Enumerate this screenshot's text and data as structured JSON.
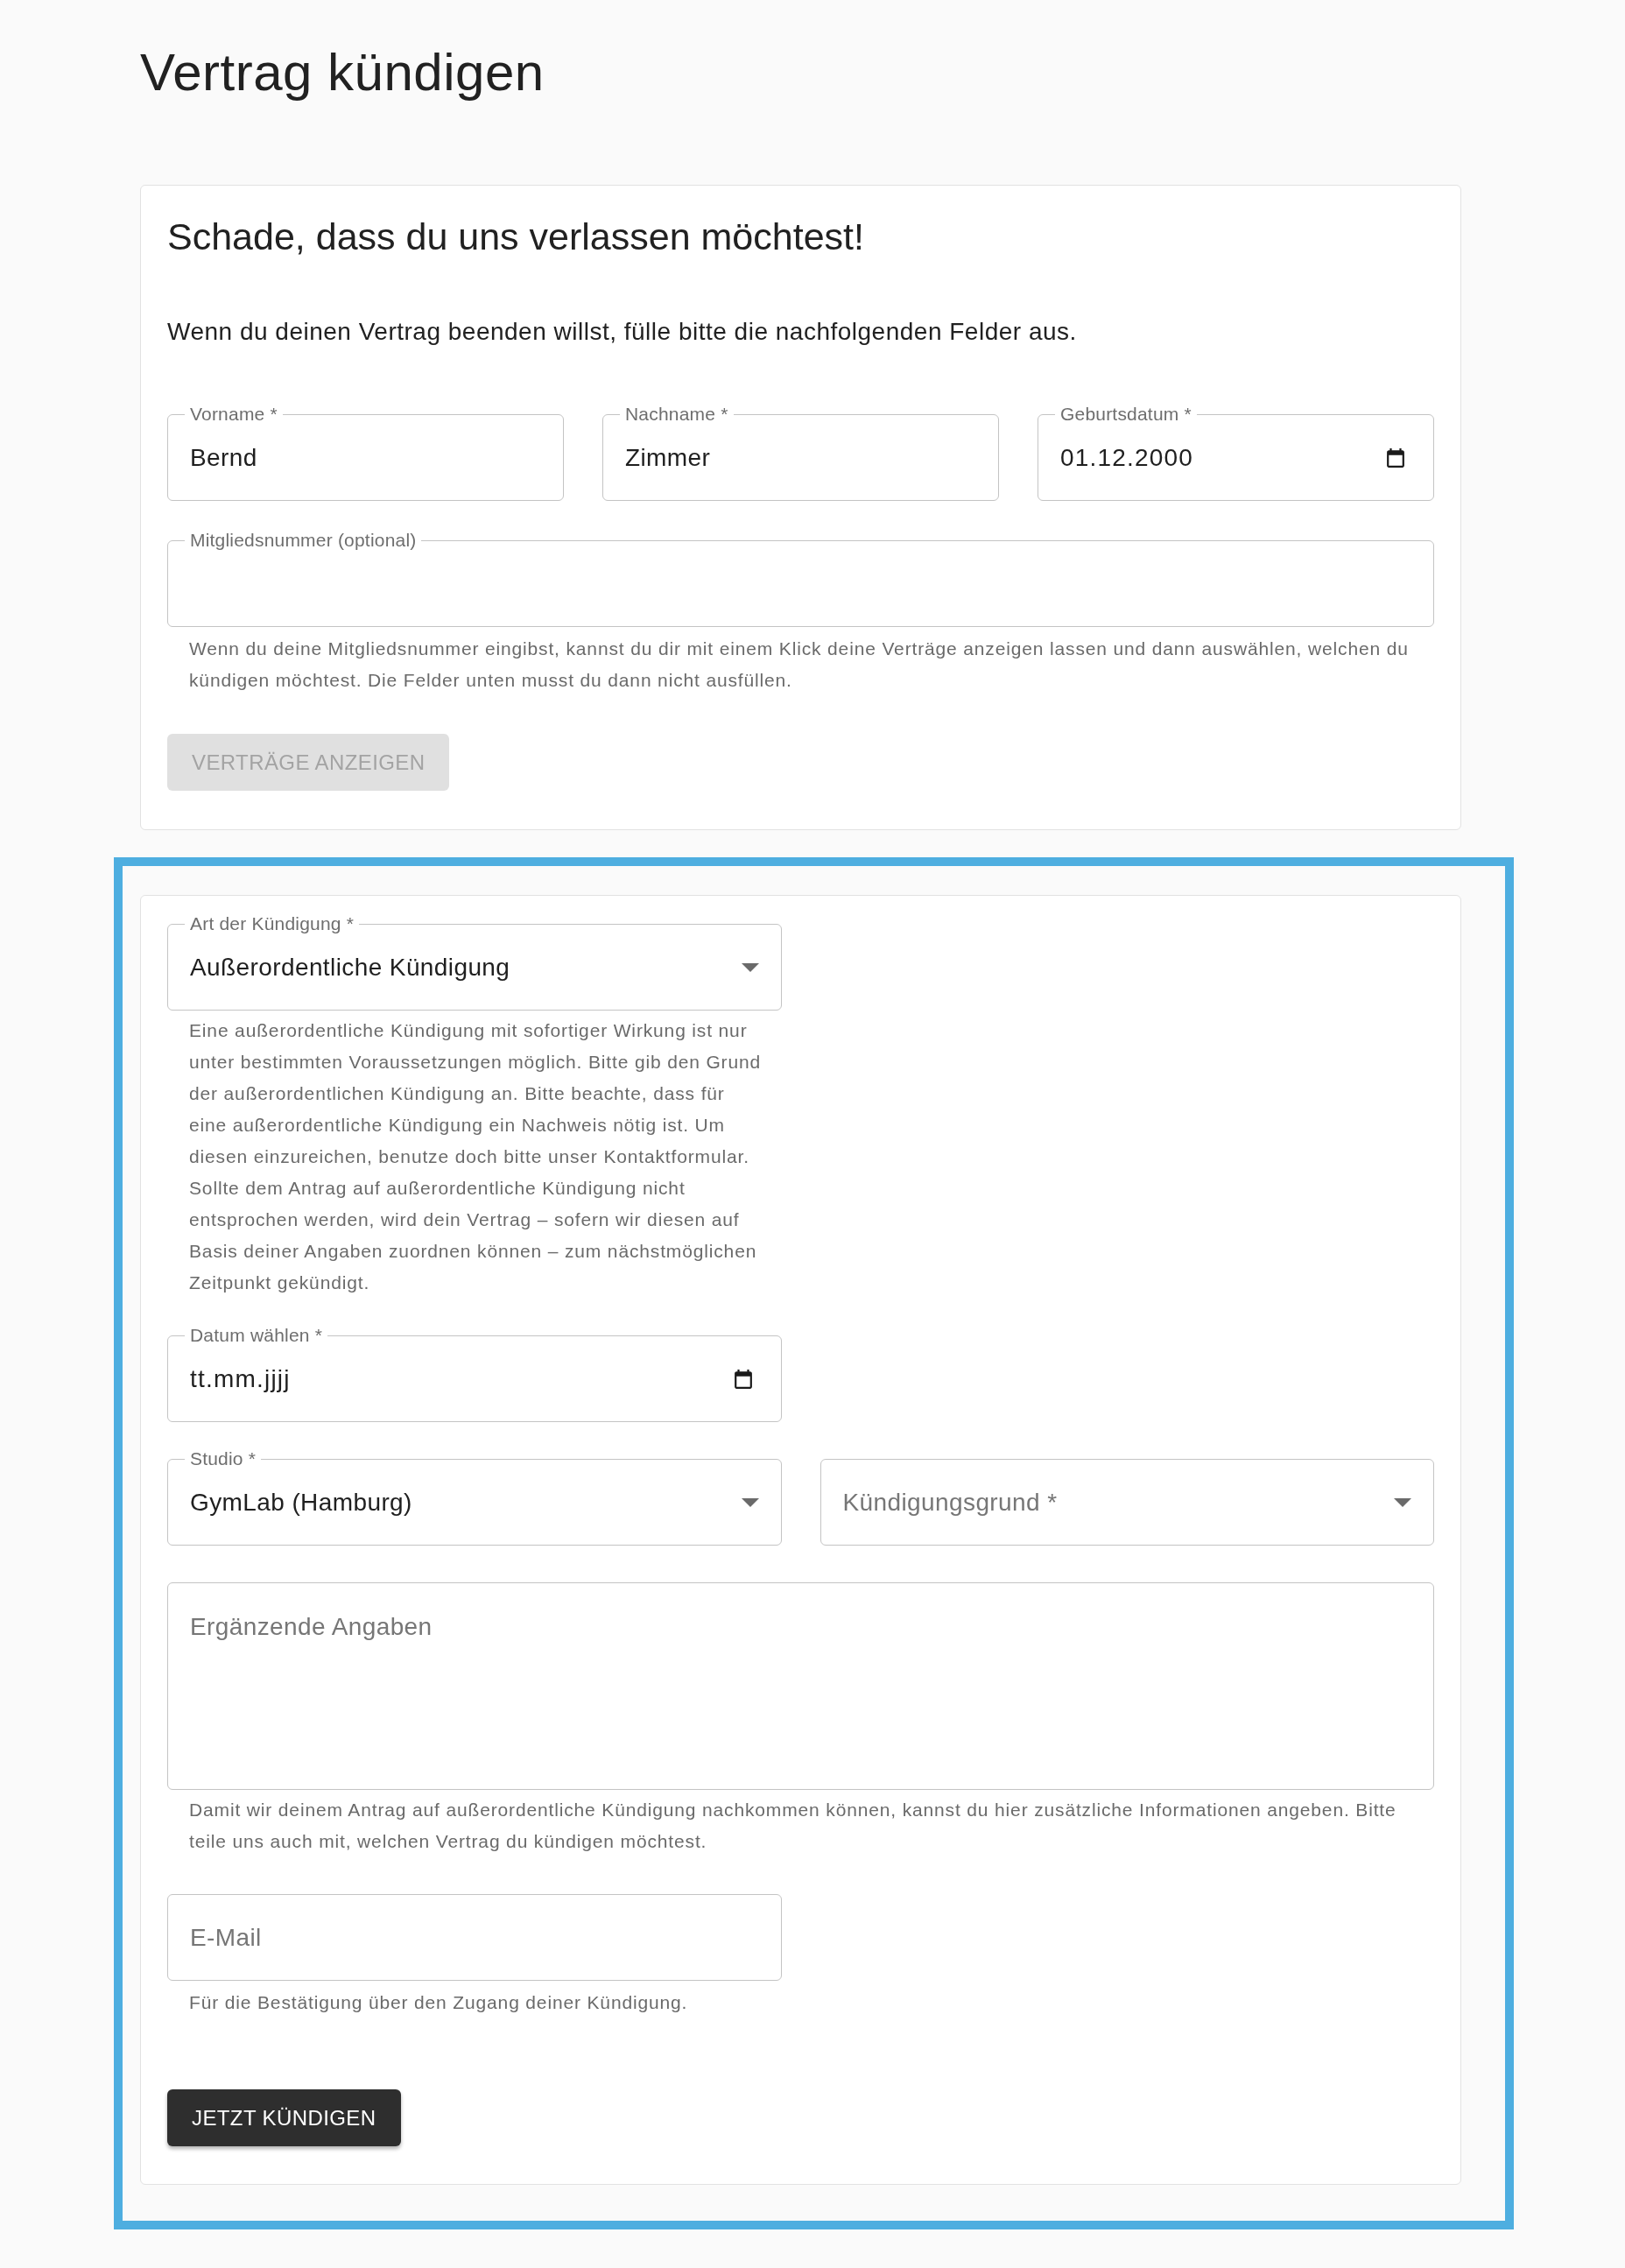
{
  "page_title": "Vertrag kündigen",
  "intro_card": {
    "heading": "Schade, dass du uns verlassen möchtest!",
    "text": "Wenn du deinen Vertrag beenden willst, fülle bitte die nachfolgenden Felder aus.",
    "fields": [
      {
        "kind": "text",
        "label": "Vorname *",
        "value": "Bernd"
      },
      {
        "kind": "text",
        "label": "Nachname *",
        "value": "Zimmer"
      },
      {
        "kind": "date",
        "label": "Geburtsdatum *",
        "value": "01.12.2000"
      }
    ],
    "member_field": {
      "kind": "text",
      "label": "Mitgliedsnummer (optional)",
      "helper": "Wenn du deine Mitgliedsnummer eingibst, kannst du dir mit einem Klick deine Verträge anzeigen lassen und dann auswählen, welchen du kündigen möchtest. Die Felder unten musst du dann nicht ausfüllen."
    },
    "button": {
      "label": "VERTRÄGE ANZEIGEN",
      "disabled": true
    }
  },
  "cancellation_card": {
    "highlighted": true,
    "rows": [
      {
        "fields": [
          {
            "kind": "select",
            "label": "Art der Kündigung *",
            "value": "Außerordentliche Kündigung",
            "helper": "Eine außerordentliche Kündigung mit sofortiger Wirkung ist nur unter bestimmten Voraussetzungen möglich. Bitte gib den Grund der außerordentlichen Kündigung an. Bitte beachte, dass für eine außerordentliche Kündigung ein Nachweis nötig ist. Um diesen einzureichen, benutze doch bitte unser Kontaktformular. Sollte dem Antrag auf außerordentliche Kündigung nicht entsprochen werden, wird dein Vertrag – sofern wir diesen auf Basis deiner Angaben zuordnen können – zum nächstmöglichen Zeitpunkt gekündigt."
          }
        ]
      },
      {
        "fields": [
          {
            "kind": "date",
            "label": "Datum wählen *",
            "placeholder": "tt.mm.jjjj"
          }
        ]
      },
      {
        "fields": [
          {
            "kind": "select",
            "label": "Studio *",
            "value": "GymLab (Hamburg)"
          },
          {
            "kind": "select",
            "placeholder": "Kündigungsgrund *"
          }
        ]
      },
      {
        "fields": [
          {
            "kind": "textarea",
            "placeholder": "Ergänzende Angaben",
            "helper": "Damit wir deinem Antrag auf außerordentliche Kündigung nachkommen können, kannst du hier zusätzliche Informationen angeben. Bitte teile uns auch mit, welchen Vertrag du kündigen möchtest."
          }
        ]
      },
      {
        "fields": [
          {
            "kind": "text",
            "placeholder": "E-Mail",
            "helper": "Für die Bestätigung über den Zugang deiner Kündigung."
          }
        ]
      }
    ],
    "button": {
      "label": "JETZT KÜNDIGEN",
      "disabled": false
    }
  }
}
